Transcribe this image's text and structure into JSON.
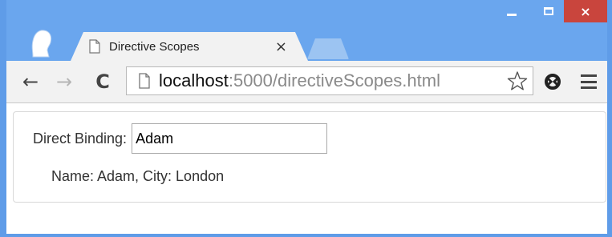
{
  "window": {
    "caption_min_icon": "minimize-icon",
    "caption_max_icon": "maximize-icon",
    "caption_close": "×"
  },
  "tab": {
    "title": "Directive Scopes",
    "close": "×",
    "icon": "page-icon"
  },
  "toolbar": {
    "back": "←",
    "forward": "→",
    "reload": "C",
    "url_host": "localhost",
    "url_rest": ":5000/directiveScopes.html",
    "star_icon": "star-icon",
    "extension_icon": "extension-icon",
    "menu_icon": "menu-icon"
  },
  "page": {
    "direct_binding_label": "Direct Binding:",
    "direct_binding_value": "Adam",
    "info_text": "Name: Adam, City: London"
  },
  "colors": {
    "frame": "#6aa6ee",
    "close_button": "#c9453d",
    "toolbar": "#f2f2f2"
  }
}
